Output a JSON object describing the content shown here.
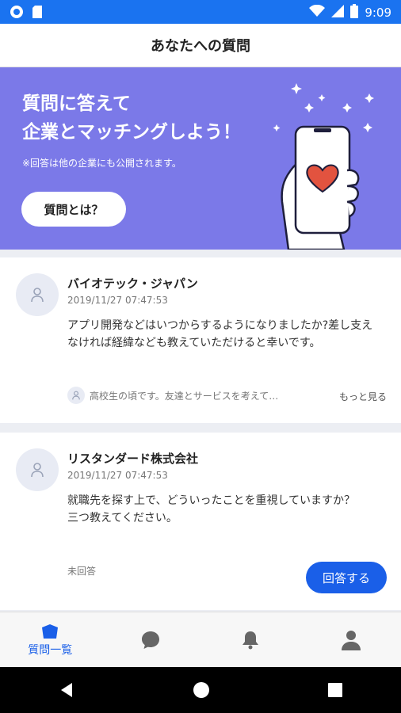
{
  "status_bar": {
    "time": "9:09"
  },
  "header": {
    "title": "あなたへの質問"
  },
  "banner": {
    "title_line1": "質問に答えて",
    "title_line2": "企業とマッチングしよう！",
    "note": "※回答は他の企業にも公開されます。",
    "button_label": "質問とは？"
  },
  "questions": [
    {
      "company": "バイオテック・ジャパン",
      "date": "2019/11/27 07:47:53",
      "text": "アプリ開発などはいつからするようになりましたか?差し支えなければ経緯なども教えていただけると幸いです。",
      "answer_preview": "高校生の頃です。友達とサービスを考えて…",
      "more_label": "もっと見る"
    },
    {
      "company": "リスタンダード株式会社",
      "date": "2019/11/27 07:47:53",
      "text_line1": "就職先を探す上で、どういったことを重視していますか？",
      "text_line2": "三つ教えてください。",
      "status": "未回答",
      "answer_button": "回答する"
    }
  ],
  "bottom_nav": {
    "questions_label": "質問一覧"
  },
  "colors": {
    "accent": "#1a5fe8",
    "banner": "#7b79e8",
    "status_bar": "#1a73f0"
  }
}
